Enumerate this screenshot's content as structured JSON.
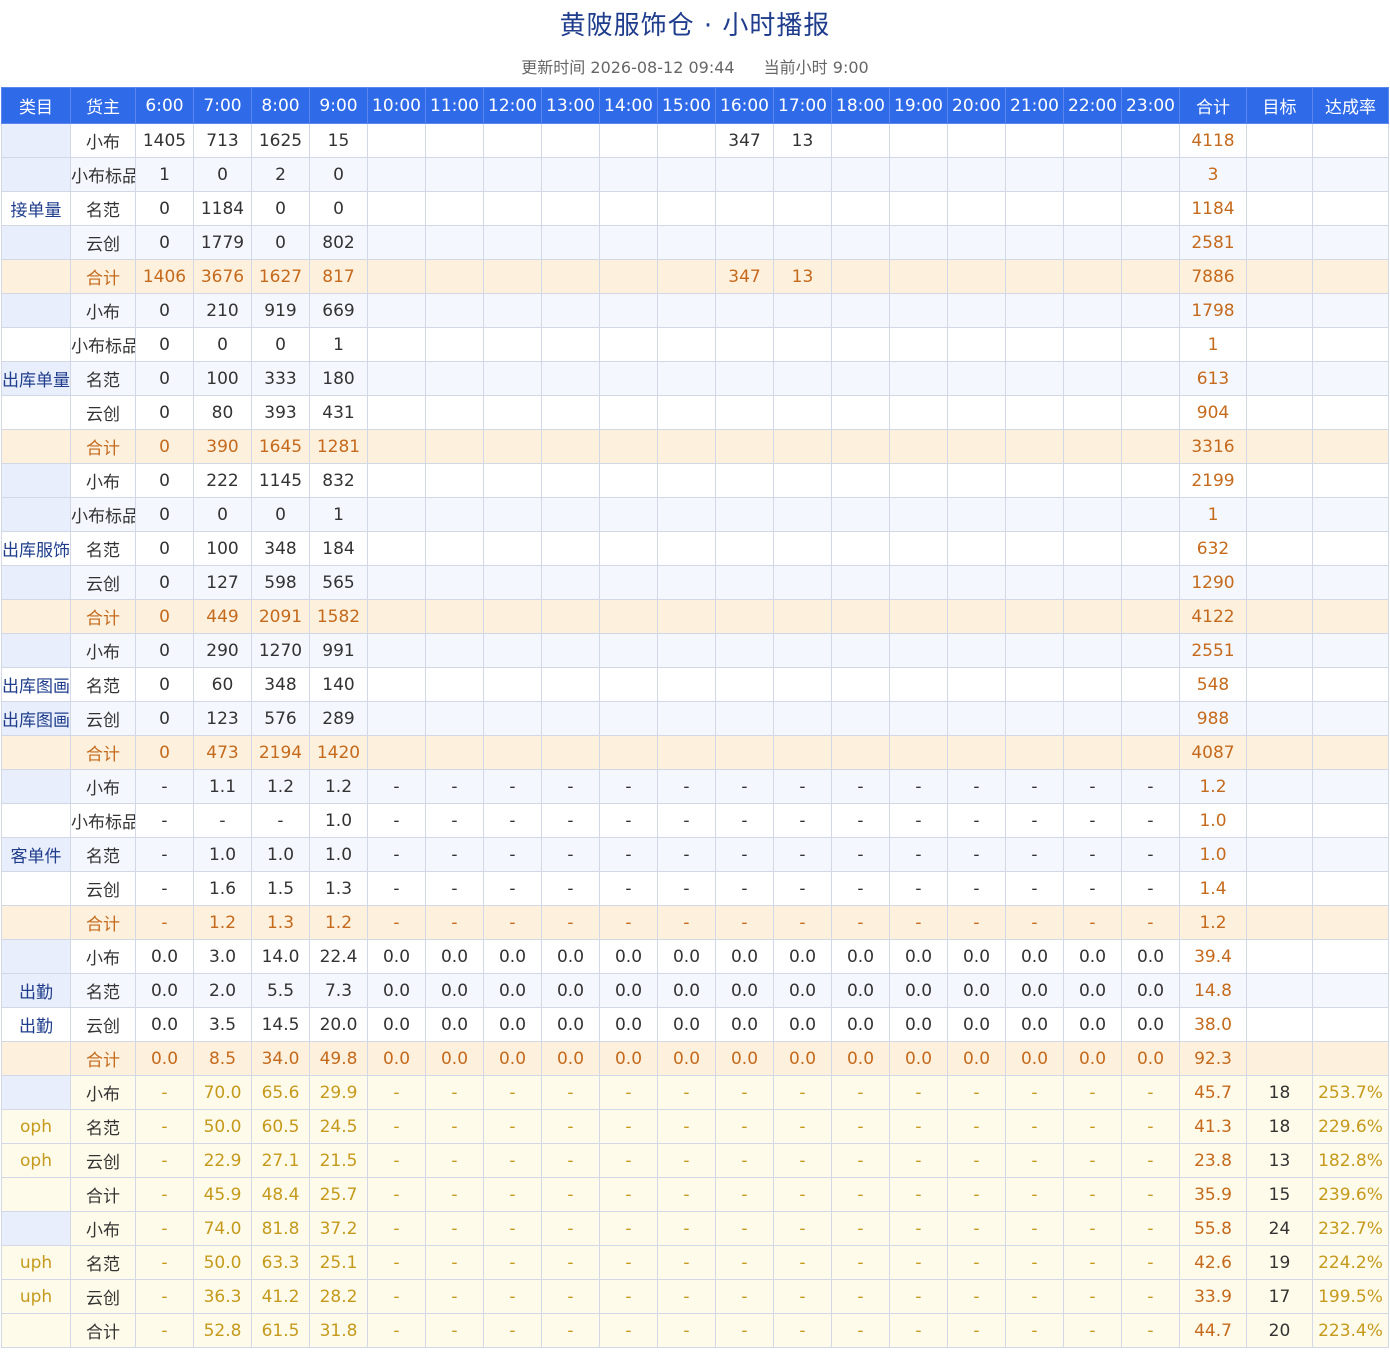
{
  "title": "黄陂服饰仓 · 小时播报",
  "update_label": "更新时间 2026-08-12 09:44",
  "current_hour_label": "当前小时 9:00",
  "headers": [
    "类目",
    "货主",
    "6:00",
    "7:00",
    "8:00",
    "9:00",
    "10:00",
    "11:00",
    "12:00",
    "13:00",
    "14:00",
    "15:00",
    "16:00",
    "17:00",
    "18:00",
    "19:00",
    "20:00",
    "21:00",
    "22:00",
    "23:00",
    "合计",
    "目标",
    "达成率"
  ],
  "sections": [
    {
      "category": "接单量",
      "rows": [
        {
          "owner": "小布",
          "hours": [
            "1405",
            "713",
            "1625",
            "15",
            "",
            "",
            "",
            "",
            "",
            "",
            "347",
            "13",
            "",
            "",
            "",
            "",
            "",
            ""
          ],
          "sum": "4118",
          "target": "",
          "rate": ""
        },
        {
          "owner": "小布标品",
          "hours": [
            "1",
            "0",
            "2",
            "0",
            "",
            "",
            "",
            "",
            "",
            "",
            "",
            "",
            "",
            "",
            "",
            "",
            "",
            ""
          ],
          "sum": "3",
          "target": "",
          "rate": ""
        },
        {
          "owner": "名范",
          "hours": [
            "0",
            "1184",
            "0",
            "0",
            "",
            "",
            "",
            "",
            "",
            "",
            "",
            "",
            "",
            "",
            "",
            "",
            "",
            ""
          ],
          "sum": "1184",
          "target": "",
          "rate": ""
        },
        {
          "owner": "云创",
          "hours": [
            "0",
            "1779",
            "0",
            "802",
            "",
            "",
            "",
            "",
            "",
            "",
            "",
            "",
            "",
            "",
            "",
            "",
            "",
            ""
          ],
          "sum": "2581",
          "target": "",
          "rate": ""
        },
        {
          "owner": "合计",
          "hours": [
            "1406",
            "3676",
            "1627",
            "817",
            "",
            "",
            "",
            "",
            "",
            "",
            "347",
            "13",
            "",
            "",
            "",
            "",
            "",
            ""
          ],
          "sum": "7886",
          "target": "",
          "rate": ""
        }
      ]
    },
    {
      "category": "出库单量",
      "rows": [
        {
          "owner": "小布",
          "hours": [
            "0",
            "210",
            "919",
            "669",
            "",
            "",
            "",
            "",
            "",
            "",
            "",
            "",
            "",
            "",
            "",
            "",
            "",
            ""
          ],
          "sum": "1798",
          "target": "",
          "rate": ""
        },
        {
          "owner": "小布标品",
          "hours": [
            "0",
            "0",
            "0",
            "1",
            "",
            "",
            "",
            "",
            "",
            "",
            "",
            "",
            "",
            "",
            "",
            "",
            "",
            ""
          ],
          "sum": "1",
          "target": "",
          "rate": ""
        },
        {
          "owner": "名范",
          "hours": [
            "0",
            "100",
            "333",
            "180",
            "",
            "",
            "",
            "",
            "",
            "",
            "",
            "",
            "",
            "",
            "",
            "",
            "",
            ""
          ],
          "sum": "613",
          "target": "",
          "rate": ""
        },
        {
          "owner": "云创",
          "hours": [
            "0",
            "80",
            "393",
            "431",
            "",
            "",
            "",
            "",
            "",
            "",
            "",
            "",
            "",
            "",
            "",
            "",
            "",
            ""
          ],
          "sum": "904",
          "target": "",
          "rate": ""
        },
        {
          "owner": "合计",
          "hours": [
            "0",
            "390",
            "1645",
            "1281",
            "",
            "",
            "",
            "",
            "",
            "",
            "",
            "",
            "",
            "",
            "",
            "",
            "",
            ""
          ],
          "sum": "3316",
          "target": "",
          "rate": ""
        }
      ]
    },
    {
      "category": "出库服饰",
      "rows": [
        {
          "owner": "小布",
          "hours": [
            "0",
            "222",
            "1145",
            "832",
            "",
            "",
            "",
            "",
            "",
            "",
            "",
            "",
            "",
            "",
            "",
            "",
            "",
            ""
          ],
          "sum": "2199",
          "target": "",
          "rate": ""
        },
        {
          "owner": "小布标品",
          "hours": [
            "0",
            "0",
            "0",
            "1",
            "",
            "",
            "",
            "",
            "",
            "",
            "",
            "",
            "",
            "",
            "",
            "",
            "",
            ""
          ],
          "sum": "1",
          "target": "",
          "rate": ""
        },
        {
          "owner": "名范",
          "hours": [
            "0",
            "100",
            "348",
            "184",
            "",
            "",
            "",
            "",
            "",
            "",
            "",
            "",
            "",
            "",
            "",
            "",
            "",
            ""
          ],
          "sum": "632",
          "target": "",
          "rate": ""
        },
        {
          "owner": "云创",
          "hours": [
            "0",
            "127",
            "598",
            "565",
            "",
            "",
            "",
            "",
            "",
            "",
            "",
            "",
            "",
            "",
            "",
            "",
            "",
            ""
          ],
          "sum": "1290",
          "target": "",
          "rate": ""
        },
        {
          "owner": "合计",
          "hours": [
            "0",
            "449",
            "2091",
            "1582",
            "",
            "",
            "",
            "",
            "",
            "",
            "",
            "",
            "",
            "",
            "",
            "",
            "",
            ""
          ],
          "sum": "4122",
          "target": "",
          "rate": ""
        }
      ]
    },
    {
      "category": "出库图画",
      "rows": [
        {
          "owner": "小布",
          "hours": [
            "0",
            "290",
            "1270",
            "991",
            "",
            "",
            "",
            "",
            "",
            "",
            "",
            "",
            "",
            "",
            "",
            "",
            "",
            ""
          ],
          "sum": "2551",
          "target": "",
          "rate": ""
        },
        {
          "owner": "名范",
          "hours": [
            "0",
            "60",
            "348",
            "140",
            "",
            "",
            "",
            "",
            "",
            "",
            "",
            "",
            "",
            "",
            "",
            "",
            "",
            ""
          ],
          "sum": "548",
          "target": "",
          "rate": ""
        },
        {
          "owner": "云创",
          "hours": [
            "0",
            "123",
            "576",
            "289",
            "",
            "",
            "",
            "",
            "",
            "",
            "",
            "",
            "",
            "",
            "",
            "",
            "",
            ""
          ],
          "sum": "988",
          "target": "",
          "rate": ""
        },
        {
          "owner": "合计",
          "hours": [
            "0",
            "473",
            "2194",
            "1420",
            "",
            "",
            "",
            "",
            "",
            "",
            "",
            "",
            "",
            "",
            "",
            "",
            "",
            ""
          ],
          "sum": "4087",
          "target": "",
          "rate": ""
        }
      ]
    },
    {
      "category": "客单件",
      "rows": [
        {
          "owner": "小布",
          "hours": [
            "-",
            "1.1",
            "1.2",
            "1.2",
            "-",
            "-",
            "-",
            "-",
            "-",
            "-",
            "-",
            "-",
            "-",
            "-",
            "-",
            "-",
            "-",
            "-"
          ],
          "sum": "1.2",
          "target": "",
          "rate": ""
        },
        {
          "owner": "小布标品",
          "hours": [
            "-",
            "-",
            "-",
            "1.0",
            "-",
            "-",
            "-",
            "-",
            "-",
            "-",
            "-",
            "-",
            "-",
            "-",
            "-",
            "-",
            "-",
            "-"
          ],
          "sum": "1.0",
          "target": "",
          "rate": ""
        },
        {
          "owner": "名范",
          "hours": [
            "-",
            "1.0",
            "1.0",
            "1.0",
            "-",
            "-",
            "-",
            "-",
            "-",
            "-",
            "-",
            "-",
            "-",
            "-",
            "-",
            "-",
            "-",
            "-"
          ],
          "sum": "1.0",
          "target": "",
          "rate": ""
        },
        {
          "owner": "云创",
          "hours": [
            "-",
            "1.6",
            "1.5",
            "1.3",
            "-",
            "-",
            "-",
            "-",
            "-",
            "-",
            "-",
            "-",
            "-",
            "-",
            "-",
            "-",
            "-",
            "-"
          ],
          "sum": "1.4",
          "target": "",
          "rate": ""
        },
        {
          "owner": "合计",
          "hours": [
            "-",
            "1.2",
            "1.3",
            "1.2",
            "-",
            "-",
            "-",
            "-",
            "-",
            "-",
            "-",
            "-",
            "-",
            "-",
            "-",
            "-",
            "-",
            "-"
          ],
          "sum": "1.2",
          "target": "",
          "rate": ""
        }
      ]
    },
    {
      "category": "出勤",
      "rows": [
        {
          "owner": "小布",
          "hours": [
            "0.0",
            "3.0",
            "14.0",
            "22.4",
            "0.0",
            "0.0",
            "0.0",
            "0.0",
            "0.0",
            "0.0",
            "0.0",
            "0.0",
            "0.0",
            "0.0",
            "0.0",
            "0.0",
            "0.0",
            "0.0"
          ],
          "sum": "39.4",
          "target": "",
          "rate": ""
        },
        {
          "owner": "名范",
          "hours": [
            "0.0",
            "2.0",
            "5.5",
            "7.3",
            "0.0",
            "0.0",
            "0.0",
            "0.0",
            "0.0",
            "0.0",
            "0.0",
            "0.0",
            "0.0",
            "0.0",
            "0.0",
            "0.0",
            "0.0",
            "0.0"
          ],
          "sum": "14.8",
          "target": "",
          "rate": ""
        },
        {
          "owner": "云创",
          "hours": [
            "0.0",
            "3.5",
            "14.5",
            "20.0",
            "0.0",
            "0.0",
            "0.0",
            "0.0",
            "0.0",
            "0.0",
            "0.0",
            "0.0",
            "0.0",
            "0.0",
            "0.0",
            "0.0",
            "0.0",
            "0.0"
          ],
          "sum": "38.0",
          "target": "",
          "rate": ""
        },
        {
          "owner": "合计",
          "hours": [
            "0.0",
            "8.5",
            "34.0",
            "49.8",
            "0.0",
            "0.0",
            "0.0",
            "0.0",
            "0.0",
            "0.0",
            "0.0",
            "0.0",
            "0.0",
            "0.0",
            "0.0",
            "0.0",
            "0.0",
            "0.0"
          ],
          "sum": "92.3",
          "target": "",
          "rate": ""
        }
      ]
    },
    {
      "category": "oph",
      "style": "yellow",
      "rows": [
        {
          "owner": "小布",
          "hours": [
            "-",
            "70.0",
            "65.6",
            "29.9",
            "-",
            "-",
            "-",
            "-",
            "-",
            "-",
            "-",
            "-",
            "-",
            "-",
            "-",
            "-",
            "-",
            "-"
          ],
          "sum": "45.7",
          "target": "18",
          "rate": "253.7%"
        },
        {
          "owner": "名范",
          "hours": [
            "-",
            "50.0",
            "60.5",
            "24.5",
            "-",
            "-",
            "-",
            "-",
            "-",
            "-",
            "-",
            "-",
            "-",
            "-",
            "-",
            "-",
            "-",
            "-"
          ],
          "sum": "41.3",
          "target": "18",
          "rate": "229.6%"
        },
        {
          "owner": "云创",
          "hours": [
            "-",
            "22.9",
            "27.1",
            "21.5",
            "-",
            "-",
            "-",
            "-",
            "-",
            "-",
            "-",
            "-",
            "-",
            "-",
            "-",
            "-",
            "-",
            "-"
          ],
          "sum": "23.8",
          "target": "13",
          "rate": "182.8%"
        },
        {
          "owner": "合计",
          "hours": [
            "-",
            "45.9",
            "48.4",
            "25.7",
            "-",
            "-",
            "-",
            "-",
            "-",
            "-",
            "-",
            "-",
            "-",
            "-",
            "-",
            "-",
            "-",
            "-"
          ],
          "sum": "35.9",
          "target": "15",
          "rate": "239.6%"
        }
      ]
    },
    {
      "category": "uph",
      "style": "yellow",
      "rows": [
        {
          "owner": "小布",
          "hours": [
            "-",
            "74.0",
            "81.8",
            "37.2",
            "-",
            "-",
            "-",
            "-",
            "-",
            "-",
            "-",
            "-",
            "-",
            "-",
            "-",
            "-",
            "-",
            "-"
          ],
          "sum": "55.8",
          "target": "24",
          "rate": "232.7%"
        },
        {
          "owner": "名范",
          "hours": [
            "-",
            "50.0",
            "63.3",
            "25.1",
            "-",
            "-",
            "-",
            "-",
            "-",
            "-",
            "-",
            "-",
            "-",
            "-",
            "-",
            "-",
            "-",
            "-"
          ],
          "sum": "42.6",
          "target": "19",
          "rate": "224.2%"
        },
        {
          "owner": "云创",
          "hours": [
            "-",
            "36.3",
            "41.2",
            "28.2",
            "-",
            "-",
            "-",
            "-",
            "-",
            "-",
            "-",
            "-",
            "-",
            "-",
            "-",
            "-",
            "-",
            "-"
          ],
          "sum": "33.9",
          "target": "17",
          "rate": "199.5%"
        },
        {
          "owner": "合计",
          "hours": [
            "-",
            "52.8",
            "61.5",
            "31.8",
            "-",
            "-",
            "-",
            "-",
            "-",
            "-",
            "-",
            "-",
            "-",
            "-",
            "-",
            "-",
            "-",
            "-"
          ],
          "sum": "44.7",
          "target": "20",
          "rate": "223.4%"
        }
      ]
    }
  ]
}
